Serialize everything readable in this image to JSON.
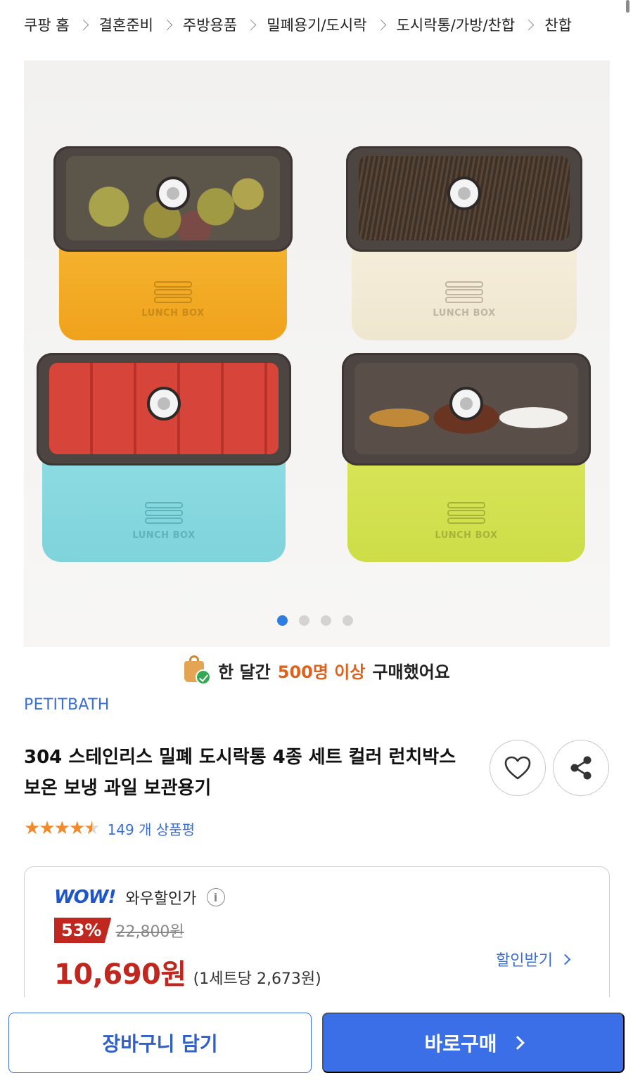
{
  "breadcrumb": [
    "쿠팡 홈",
    "결혼준비",
    "주방용품",
    "밀폐용기/도시락",
    "도시락통/가방/찬합",
    "찬합"
  ],
  "image": {
    "boxes": [
      {
        "color": "yellow",
        "logo": "LUNCH BOX"
      },
      {
        "color": "cream",
        "logo": "LUNCH BOX"
      },
      {
        "color": "mint",
        "logo": "LUNCH BOX"
      },
      {
        "color": "lime",
        "logo": "LUNCH BOX"
      }
    ],
    "pagination": {
      "total": 4,
      "active": 1
    }
  },
  "purchase_banner": {
    "prefix": "한 달간",
    "highlight": "500명 이상",
    "suffix": "구매했어요"
  },
  "brand": "PETITBATH",
  "title": "304 스테인리스 밀폐 도시락통 4종 세트 컬러 런치박스 보온 보냉 과일 보관용기",
  "rating": {
    "stars": 4.5,
    "review_text": "149 개 상품평"
  },
  "price": {
    "wow_logo": "WOW!",
    "wow_label": "와우할인가",
    "discount": "53%",
    "original": "22,800원",
    "sale": "10,690원",
    "unit": "(1세트당 2,673원)",
    "coupon_label": "할인받기"
  },
  "actions": {
    "cart": "장바구니 담기",
    "buy": "바로구매"
  },
  "colors": {
    "accent": "#3a6fe8",
    "price": "#c0271f",
    "brand": "#3a6fd8",
    "highlight": "#e0621a"
  }
}
